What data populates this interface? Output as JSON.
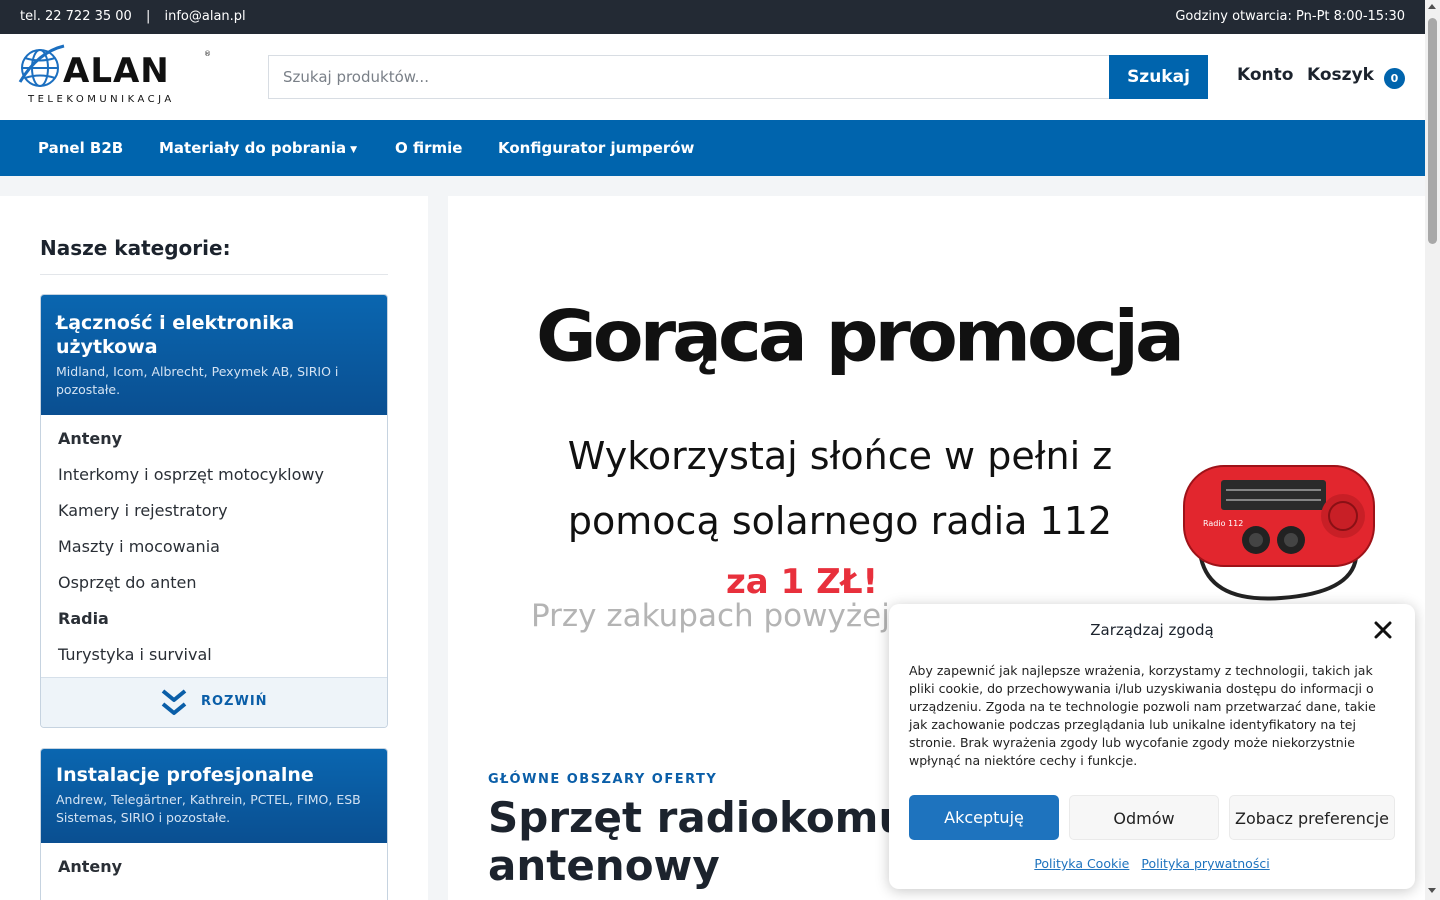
{
  "topbar": {
    "phone": "tel. 22 722 35 00",
    "separator": "|",
    "email": "info@alan.pl",
    "hours": "Godziny otwarcia: Pn-Pt 8:00-15:30"
  },
  "header": {
    "logo_text": "ALAN",
    "logo_subtext": "TELEKOMUNIKACJA",
    "search_placeholder": "Szukaj produktów...",
    "search_button": "Szukaj",
    "account": "Konto",
    "cart": "Koszyk",
    "cart_count": "0"
  },
  "nav": {
    "items": [
      {
        "label": "Panel B2B"
      },
      {
        "label": "Materiały do pobrania"
      },
      {
        "label": "O firmie"
      },
      {
        "label": "Konfigurator jumperów"
      }
    ]
  },
  "sidebar": {
    "title": "Nasze kategorie:",
    "categories": [
      {
        "title": "Łączność i elektronika użytkowa",
        "subtitle": "Midland, Icom, Albrecht, Pexymek AB, SIRIO i pozostałe.",
        "items": [
          {
            "label": "Anteny",
            "bold": true
          },
          {
            "label": "Interkomy i osprzęt motocyklowy",
            "bold": false
          },
          {
            "label": "Kamery i rejestratory",
            "bold": false
          },
          {
            "label": "Maszty i mocowania",
            "bold": false
          },
          {
            "label": "Osprzęt do anten",
            "bold": false
          },
          {
            "label": "Radia",
            "bold": true
          },
          {
            "label": "Turystyka i survival",
            "bold": false
          }
        ],
        "expand_label": "ROZWIŃ"
      },
      {
        "title": "Instalacje profesjonalne",
        "subtitle": "Andrew, Telegärtner, Kathrein, PCTEL, FIMO, ESB Sistemas, SIRIO i pozostałe.",
        "items": [
          {
            "label": "Anteny",
            "bold": true
          }
        ]
      }
    ]
  },
  "main": {
    "promo": {
      "headline": "Gorąca promocja",
      "text": "Wykorzystaj słońce w pełni z pomocą solarnego radia 112",
      "price": "za 1 ZŁ!",
      "condition": "Przy zakupach powyżej",
      "radio_label": "Radio 112"
    },
    "eyebrow": "GŁÓWNE OBSZARY OFERTY",
    "section_title": "Sprzęt radiokomunikacyjny i antenowy"
  },
  "cookie": {
    "title": "Zarządzaj zgodą",
    "text": "Aby zapewnić jak najlepsze wrażenia, korzystamy z technologii, takich jak pliki cookie, do przechowywania i/lub uzyskiwania dostępu do informacji o urządzeniu. Zgoda na te technologie pozwoli nam przetwarzać dane, takie jak zachowanie podczas przeglądania lub unikalne identyfikatory na tej stronie. Brak wyrażenia zgody lub wycofanie zgody może niekorzystnie wpłynąć na niektóre cechy i funkcje.",
    "accept": "Akceptuję",
    "deny": "Odmów",
    "preferences": "Zobacz preferencje",
    "link_cookie": "Polityka Cookie",
    "link_privacy": "Polityka prywatności"
  },
  "colors": {
    "brand_blue": "#0064ad",
    "topbar_dark": "#232a34",
    "promo_red": "#e8303c"
  }
}
